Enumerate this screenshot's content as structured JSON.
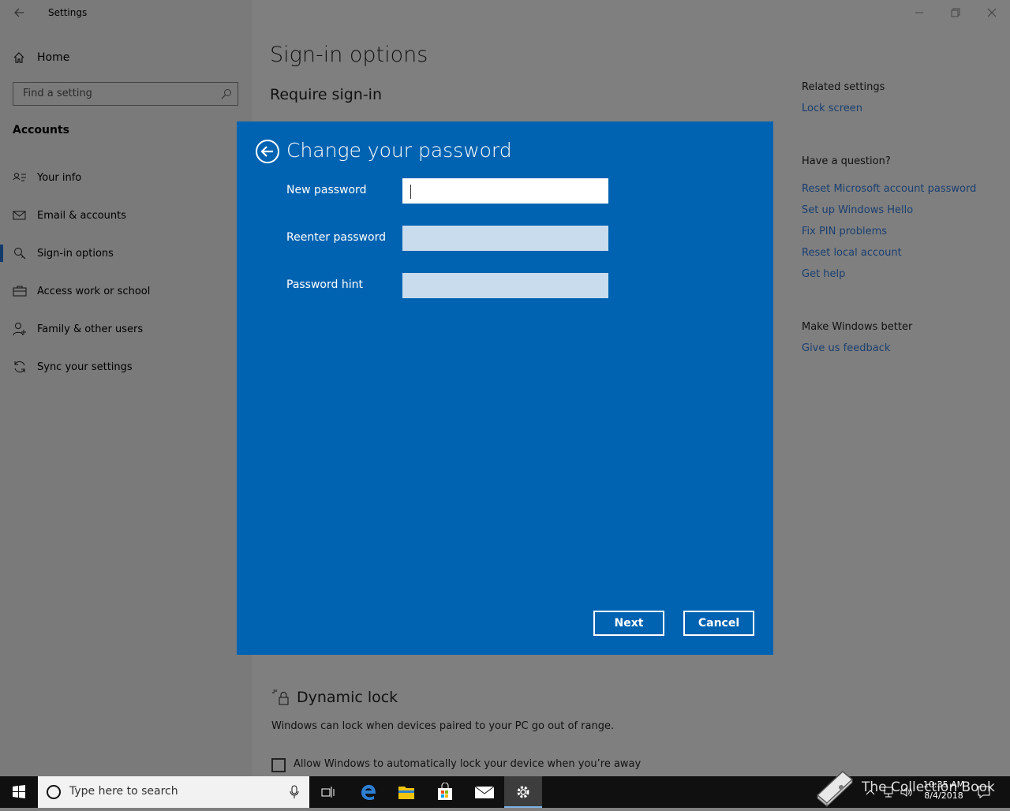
{
  "window": {
    "title": "Settings"
  },
  "sidebar": {
    "home_label": "Home",
    "search_placeholder": "Find a setting",
    "section": "Accounts",
    "items": [
      {
        "label": "Your info",
        "icon": "person-card-icon"
      },
      {
        "label": "Email & accounts",
        "icon": "mail-icon"
      },
      {
        "label": "Sign-in options",
        "icon": "key-icon",
        "active": true
      },
      {
        "label": "Access work or school",
        "icon": "briefcase-icon"
      },
      {
        "label": "Family & other users",
        "icon": "add-person-icon"
      },
      {
        "label": "Sync your settings",
        "icon": "sync-icon"
      }
    ]
  },
  "main": {
    "title": "Sign-in options",
    "subtitle": "Require sign-in",
    "dynamic_lock": {
      "title": "Dynamic lock",
      "description": "Windows can lock when devices paired to your PC go out of range.",
      "checkbox_label": "Allow Windows to automatically lock your device when you’re away",
      "checked": false
    }
  },
  "related": {
    "related_head": "Related settings",
    "lock_screen": "Lock screen",
    "question_head": "Have a question?",
    "links": [
      "Reset Microsoft account password",
      "Set up Windows Hello",
      "Fix PIN problems",
      "Reset local account",
      "Get help"
    ],
    "better_head": "Make Windows better",
    "feedback": "Give us feedback"
  },
  "dialog": {
    "title": "Change your password",
    "fields": [
      {
        "label": "New password",
        "value": ""
      },
      {
        "label": "Reenter password",
        "value": ""
      },
      {
        "label": "Password hint",
        "value": ""
      }
    ],
    "next_label": "Next",
    "cancel_label": "Cancel",
    "bg_color": "#0063b1"
  },
  "taskbar": {
    "search_text": "Type here to search",
    "clock_time": "10:35 AM",
    "clock_date": "8/4/2018",
    "apps": [
      "task-view-icon",
      "edge-icon",
      "file-explorer-icon",
      "store-icon",
      "mail-icon",
      "settings-icon"
    ]
  },
  "watermark": {
    "text": "The Collection Book"
  }
}
